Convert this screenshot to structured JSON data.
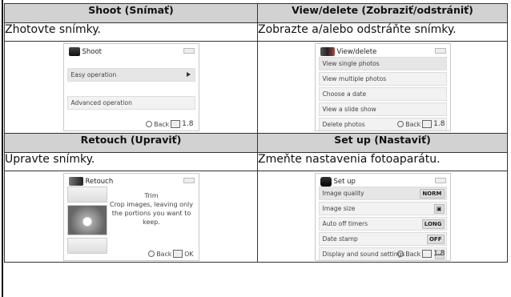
{
  "headers": {
    "shoot": "Shoot (Snímať)",
    "view": "View/delete (Zobraziť/odstrániť)",
    "retouch": "Retouch (Upraviť)",
    "setup": "Set up (Nastaviť)"
  },
  "descriptions": {
    "shoot": "Zhotovte snímky.",
    "view": "Zobrazte a/alebo odstráňte snímky.",
    "retouch": "Upravte snímky.",
    "setup": "Zmeňte nastavenia fotoaparátu."
  },
  "shoot_screen": {
    "title": "Shoot",
    "items": [
      "Easy operation",
      "Advanced operation"
    ],
    "footer_back": "Back",
    "footer_value": "1.8"
  },
  "view_screen": {
    "title": "View/delete",
    "items": [
      "View single photos",
      "View multiple photos",
      "Choose a date",
      "View a slide show",
      "Delete photos"
    ],
    "footer_back": "Back",
    "footer_value": "1.8"
  },
  "retouch_screen": {
    "title": "Retouch",
    "heading": "Trim",
    "text": "Crop images, leaving only the portions you want to keep.",
    "footer_back": "Back",
    "footer_ok": "OK"
  },
  "setup_screen": {
    "title": "Set up",
    "items": [
      {
        "label": "Image quality",
        "value": "NORM"
      },
      {
        "label": "Image size",
        "value": "▣"
      },
      {
        "label": "Auto off timers",
        "value": "LONG"
      },
      {
        "label": "Date stamp",
        "value": "OFF"
      },
      {
        "label": "Display and sound settings",
        "value": "--"
      }
    ],
    "footer_back": "Back",
    "footer_value": "1.8"
  }
}
